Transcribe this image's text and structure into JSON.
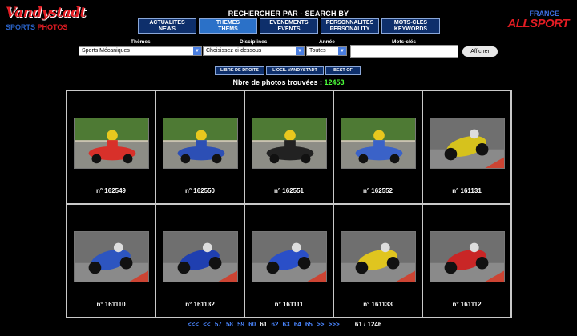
{
  "logos": {
    "left_script": "Vandystadt",
    "left_sub_1": "SPORTS",
    "left_sub_2": "PHOTOS",
    "right_top": "FRANCE",
    "right_main": "ALLSPORT"
  },
  "search": {
    "title": "RECHERCHER PAR  -  SEARCH BY",
    "buttons": [
      {
        "line1": "ACTUALITES",
        "line2": "NEWS"
      },
      {
        "line1": "THEMES",
        "line2": "THEMS"
      },
      {
        "line1": "EVENEMENTS",
        "line2": "EVENTS"
      },
      {
        "line1": "PERSONNALITES",
        "line2": "PERSONALITY"
      },
      {
        "line1": "MOTS-CLES",
        "line2": "KEYWORDS"
      }
    ]
  },
  "filters": {
    "themes_label": "Thèmes",
    "themes_value": "Sports Mécaniques",
    "disciplines_label": "Disciplines",
    "disciplines_value": "Choisissez ci-dessous",
    "annee_label": "Année",
    "annee_value": "Toutes",
    "keywords_label": "Mots-clés",
    "keywords_value": "",
    "submit_label": "Afficher"
  },
  "subnav": [
    "LIBRE DE DROITS",
    "L'OEIL VANDYSTADT",
    "BEST OF"
  ],
  "results": {
    "label": "Nbre de photos trouvées : ",
    "count": "12453"
  },
  "photos": [
    {
      "caption": "n° 162549",
      "kind": "kart"
    },
    {
      "caption": "n° 162550",
      "kind": "kart"
    },
    {
      "caption": "n° 162551",
      "kind": "kart"
    },
    {
      "caption": "n° 162552",
      "kind": "kart"
    },
    {
      "caption": "n° 161131",
      "kind": "moto"
    },
    {
      "caption": "n° 161110",
      "kind": "moto"
    },
    {
      "caption": "n° 161132",
      "kind": "moto"
    },
    {
      "caption": "n° 161111",
      "kind": "moto"
    },
    {
      "caption": "n° 161133",
      "kind": "moto"
    },
    {
      "caption": "n° 161112",
      "kind": "moto"
    }
  ],
  "pager": {
    "first": "<<<",
    "prev": "<<",
    "pages": [
      "57",
      "58",
      "59",
      "60",
      "61",
      "62",
      "63",
      "64",
      "65"
    ],
    "current": "61",
    "next": ">>",
    "last": ">>>",
    "total": "61 / 1246"
  }
}
